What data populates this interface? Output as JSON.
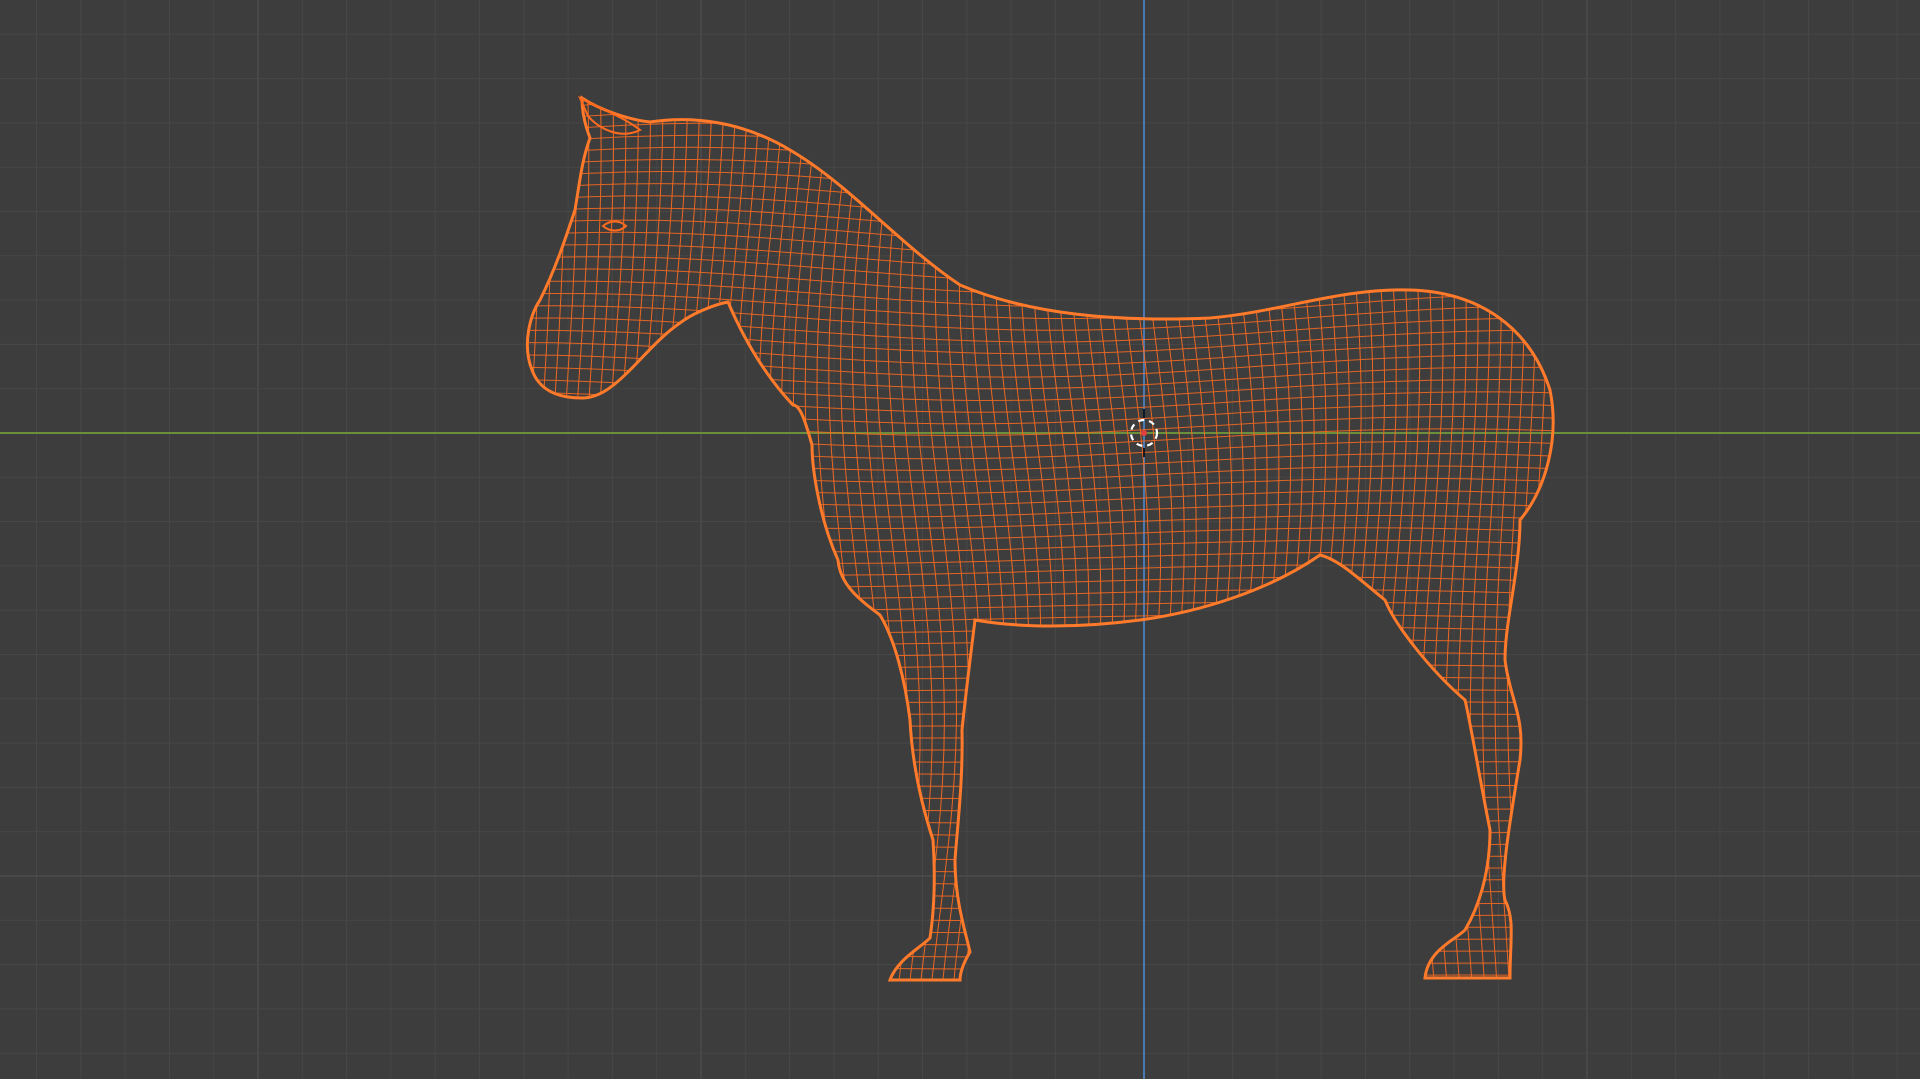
{
  "viewport": {
    "view": "wireframe",
    "object": "horse",
    "colors": {
      "background": "#3d3d3d",
      "grid_minor": "#474747",
      "grid_major": "#525252",
      "x_axis": "#6b8f3a",
      "z_axis": "#4a78b0",
      "wire_selected": "#ff6b1f",
      "wire_outline": "#ff7a2a",
      "cursor_outer": "#ffffff",
      "cursor_inner": "#e04040"
    },
    "icons": {
      "cursor": "3d-cursor-icon"
    }
  }
}
